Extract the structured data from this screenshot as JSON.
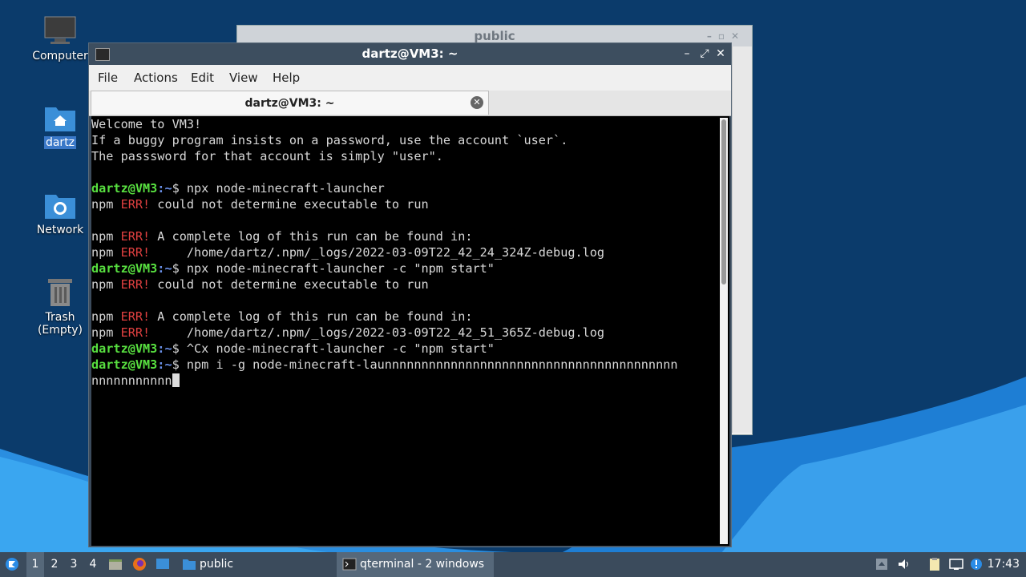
{
  "desktop": {
    "icons": [
      {
        "label": "Computer",
        "selected": false,
        "icon": "computer-icon"
      },
      {
        "label": "dartz",
        "selected": true,
        "icon": "home-folder-icon"
      },
      {
        "label": "Network",
        "selected": false,
        "icon": "network-folder-icon"
      },
      {
        "label": "Trash (Empty)",
        "selected": false,
        "icon": "trash-icon"
      }
    ]
  },
  "background_window": {
    "title": "public"
  },
  "terminal_window": {
    "title": "dartz@VM3: ~",
    "menu": [
      "File",
      "Actions",
      "Edit",
      "View",
      "Help"
    ],
    "tab_label": "dartz@VM3: ~",
    "prompt_user": "dartz@VM3",
    "prompt_dir": "~",
    "lines": [
      {
        "kind": "text",
        "text": "Welcome to VM3!"
      },
      {
        "kind": "text",
        "text": "If a buggy program insists on a password, use the account `user`."
      },
      {
        "kind": "text",
        "text": "The passsword for that account is simply \"user\"."
      },
      {
        "kind": "text",
        "text": ""
      },
      {
        "kind": "prompt",
        "cmd": "$ npx node-minecraft-launcher"
      },
      {
        "kind": "err",
        "prefix": "npm ",
        "err": "ERR!",
        "rest": " could not determine executable to run"
      },
      {
        "kind": "text",
        "text": ""
      },
      {
        "kind": "err",
        "prefix": "npm ",
        "err": "ERR!",
        "rest": " A complete log of this run can be found in:"
      },
      {
        "kind": "err",
        "prefix": "npm ",
        "err": "ERR!",
        "rest": "     /home/dartz/.npm/_logs/2022-03-09T22_42_24_324Z-debug.log"
      },
      {
        "kind": "prompt",
        "cmd": "$ npx node-minecraft-launcher -c \"npm start\""
      },
      {
        "kind": "err",
        "prefix": "npm ",
        "err": "ERR!",
        "rest": " could not determine executable to run"
      },
      {
        "kind": "text",
        "text": ""
      },
      {
        "kind": "err",
        "prefix": "npm ",
        "err": "ERR!",
        "rest": " A complete log of this run can be found in:"
      },
      {
        "kind": "err",
        "prefix": "npm ",
        "err": "ERR!",
        "rest": "     /home/dartz/.npm/_logs/2022-03-09T22_42_51_365Z-debug.log"
      },
      {
        "kind": "prompt",
        "cmd": "$ ^Cx node-minecraft-launcher -c \"npm start\""
      },
      {
        "kind": "prompt",
        "cmd": "$ npm i -g node-minecraft-launnnnnnnnnnnnnnnnnnnnnnnnnnnnnnnnnnnnnnnn"
      },
      {
        "kind": "cursorline",
        "text": "nnnnnnnnnnn"
      }
    ]
  },
  "taskbar": {
    "workspaces": [
      "1",
      "2",
      "3",
      "4"
    ],
    "active_workspace": "1",
    "folder_task": "public",
    "terminal_task": "qterminal - 2 windows",
    "clock": "17:43"
  }
}
